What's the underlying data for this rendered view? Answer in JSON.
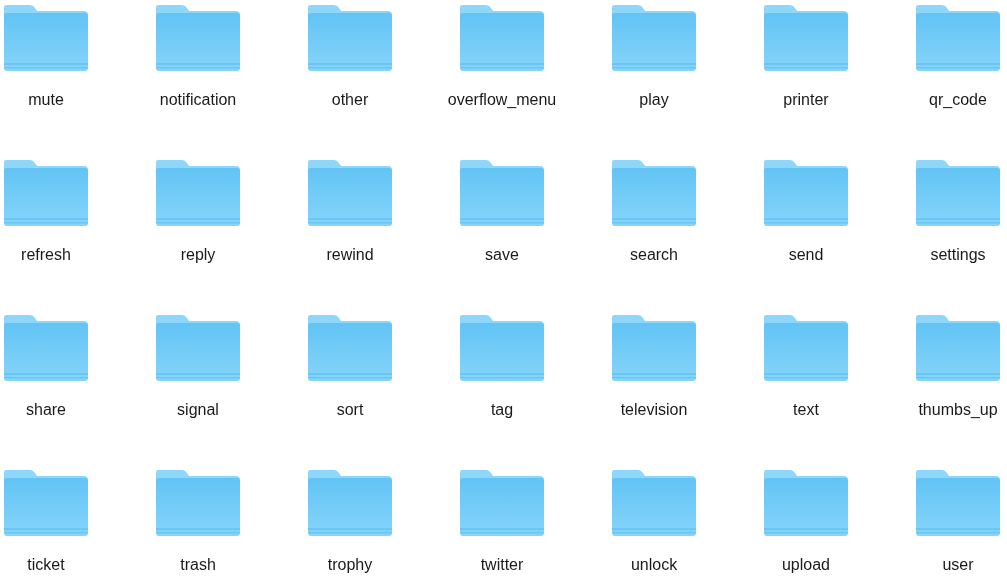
{
  "folders": [
    {
      "name": "mute"
    },
    {
      "name": "notification"
    },
    {
      "name": "other"
    },
    {
      "name": "overflow_menu"
    },
    {
      "name": "play"
    },
    {
      "name": "printer"
    },
    {
      "name": "qr_code"
    },
    {
      "name": "refresh"
    },
    {
      "name": "reply"
    },
    {
      "name": "rewind"
    },
    {
      "name": "save"
    },
    {
      "name": "search"
    },
    {
      "name": "send"
    },
    {
      "name": "settings"
    },
    {
      "name": "share"
    },
    {
      "name": "signal"
    },
    {
      "name": "sort"
    },
    {
      "name": "tag"
    },
    {
      "name": "television"
    },
    {
      "name": "text"
    },
    {
      "name": "thumbs_up"
    },
    {
      "name": "ticket"
    },
    {
      "name": "trash"
    },
    {
      "name": "trophy"
    },
    {
      "name": "twitter"
    },
    {
      "name": "unlock"
    },
    {
      "name": "upload"
    },
    {
      "name": "user"
    }
  ]
}
